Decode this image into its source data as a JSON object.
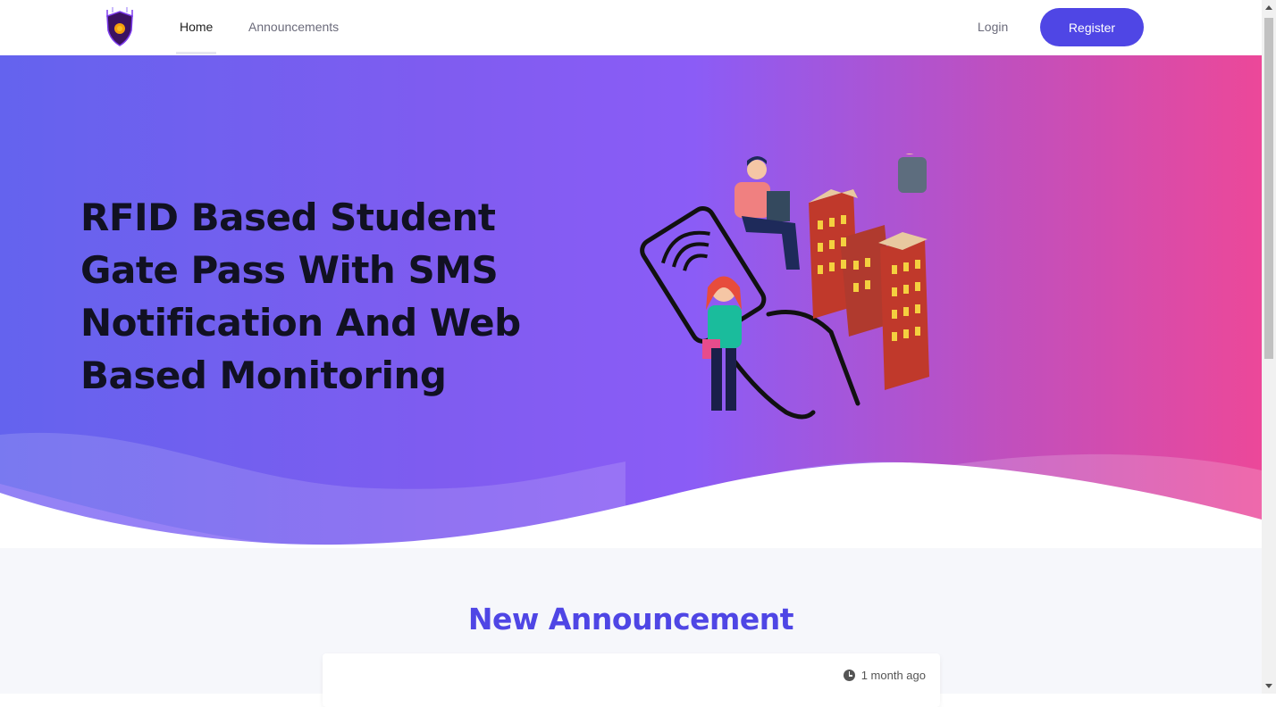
{
  "nav": {
    "home_label": "Home",
    "announcements_label": "Announcements",
    "login_label": "Login",
    "register_label": "Register"
  },
  "hero": {
    "title": "RFID Based Student Gate Pass With SMS Notification And Web Based Monitoring"
  },
  "announcements": {
    "section_title": "New Announcement",
    "items": [
      {
        "time": "1 month ago"
      }
    ]
  },
  "colors": {
    "brand": "#4f46e5",
    "gradient_start": "#6463ee",
    "gradient_end": "#ec4899"
  },
  "icons": [
    "shield-logo-icon",
    "clock-icon",
    "rfid-card-illustration"
  ]
}
